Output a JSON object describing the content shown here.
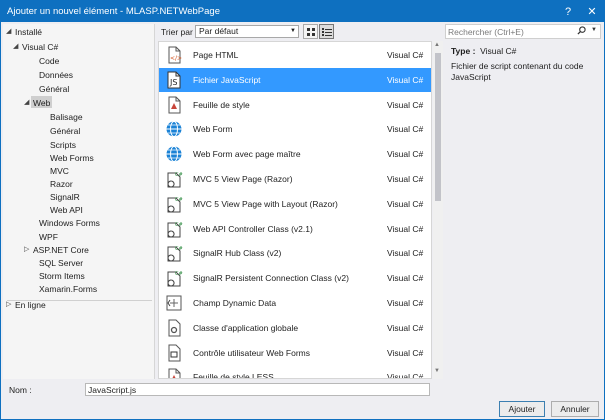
{
  "window": {
    "title": "Ajouter un nouvel élément - MLASP.NETWebPage",
    "help": "?",
    "close": "✕"
  },
  "tree": {
    "items": [
      {
        "label": "Installé",
        "arrow": "◢"
      },
      {
        "label": "Visual C#",
        "arrow": "◢"
      },
      {
        "label": "Code"
      },
      {
        "label": "Données"
      },
      {
        "label": "Général"
      },
      {
        "label": "Web",
        "arrow": "◢"
      },
      {
        "label": "Balisage"
      },
      {
        "label": "Général"
      },
      {
        "label": "Scripts"
      },
      {
        "label": "Web Forms"
      },
      {
        "label": "MVC"
      },
      {
        "label": "Razor"
      },
      {
        "label": "SignalR"
      },
      {
        "label": "Web API"
      },
      {
        "label": "Windows Forms"
      },
      {
        "label": "WPF"
      },
      {
        "label": "ASP.NET Core",
        "arrow": "▷"
      },
      {
        "label": "SQL Server"
      },
      {
        "label": "Storm Items"
      },
      {
        "label": "Xamarin.Forms"
      },
      {
        "label": "En ligne",
        "arrow": "▷"
      }
    ]
  },
  "toolbar": {
    "sort_label": "Trier par :",
    "sort_value": "Par défaut",
    "sort_arrow": "▼"
  },
  "search": {
    "placeholder": "Rechercher (Ctrl+E)",
    "icon": "search-icon",
    "dropdown": "▼"
  },
  "templates": [
    {
      "name": "Page HTML",
      "lang": "Visual C#",
      "icon": "html-page-icon"
    },
    {
      "name": "Fichier JavaScript",
      "lang": "Visual C#",
      "icon": "javascript-file-icon"
    },
    {
      "name": "Feuille de style",
      "lang": "Visual C#",
      "icon": "stylesheet-icon"
    },
    {
      "name": "Web Form",
      "lang": "Visual C#",
      "icon": "globe-icon"
    },
    {
      "name": "Web Form avec page maître",
      "lang": "Visual C#",
      "icon": "globe-icon"
    },
    {
      "name": "MVC 5 View Page (Razor)",
      "lang": "Visual C#",
      "icon": "csharp-page-icon"
    },
    {
      "name": "MVC 5 View Page with Layout (Razor)",
      "lang": "Visual C#",
      "icon": "csharp-page-icon"
    },
    {
      "name": "Web API Controller Class (v2.1)",
      "lang": "Visual C#",
      "icon": "csharp-page-icon"
    },
    {
      "name": "SignalR Hub Class (v2)",
      "lang": "Visual C#",
      "icon": "csharp-page-icon"
    },
    {
      "name": "SignalR Persistent Connection Class (v2)",
      "lang": "Visual C#",
      "icon": "csharp-page-icon"
    },
    {
      "name": "Champ Dynamic Data",
      "lang": "Visual C#",
      "icon": "dynamic-data-icon"
    },
    {
      "name": "Classe d'application globale",
      "lang": "Visual C#",
      "icon": "gear-page-icon"
    },
    {
      "name": "Contrôle utilisateur Web Forms",
      "lang": "Visual C#",
      "icon": "user-control-icon"
    },
    {
      "name": "Feuille de style LESS",
      "lang": "Visual C#",
      "icon": "stylesheet-icon"
    }
  ],
  "selected_index": 1,
  "details": {
    "type_label": "Type :",
    "type_value": "Visual C#",
    "description": "Fichier de script contenant du code JavaScript"
  },
  "name_field": {
    "label": "Nom :",
    "value": "JavaScript.js"
  },
  "buttons": {
    "add": "Ajouter",
    "cancel": "Annuler"
  },
  "colors": {
    "accent": "#0e70c0",
    "selection": "#3399ff"
  }
}
